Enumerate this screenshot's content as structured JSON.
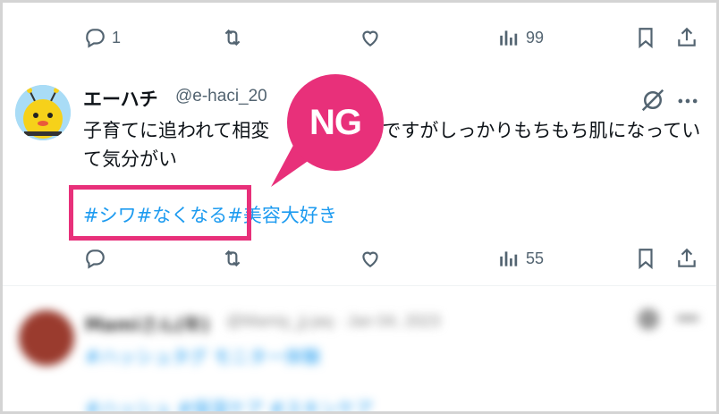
{
  "top_actions": {
    "reply_count": "1",
    "repost_count": "",
    "like_count": "",
    "views_count": "99"
  },
  "post": {
    "display_name": "エーハチ",
    "handle": "@e-haci_20",
    "text": "子育てに追われて相変わらず睡眠不足ですがしっかりもちもち肌になっていて気分がいい♪",
    "text_visible": "子育てに追われて相変　　　寝不足ですがしっかりもちもち肌になっていて気分がい",
    "hashtags": [
      "#シワ",
      "#なくなる",
      "#美容大好き"
    ],
    "reply_count": "",
    "repost_count": "",
    "like_count": "",
    "views_count": "55"
  },
  "annotation": {
    "label": "NG",
    "color": "#e8307a"
  },
  "blurred_post": {
    "display_name": "Mamiさん(年)",
    "handle": "@Mamiy_jj-jaq · Jan 04, 2023",
    "line1": "#ハッシュタグ モニター体験",
    "line2": "#ハッシュ #保湿ケア #スキンケア"
  },
  "colors": {
    "accent": "#1d9bf0",
    "muted": "#536471",
    "highlight": "#e8307a"
  }
}
